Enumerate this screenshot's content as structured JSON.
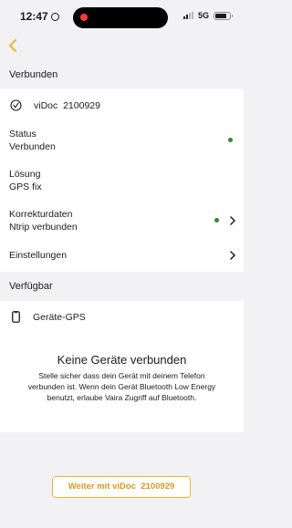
{
  "status_bar": {
    "time": "12:47",
    "network": "5G"
  },
  "sections": {
    "connected": "Verbunden",
    "available": "Verfügbar"
  },
  "device": {
    "name": "viDoc  2100929"
  },
  "rows": {
    "status": {
      "label": "Status",
      "value": "Verbunden"
    },
    "solution": {
      "label": "Lösung",
      "value": "GPS fix"
    },
    "corrections": {
      "label": "Korrekturdaten",
      "value": "Ntrip verbunden"
    },
    "settings": {
      "label": "Einstellungen"
    }
  },
  "available_device": {
    "name": "Geräte-GPS"
  },
  "empty_state": {
    "title": "Keine Geräte verbunden",
    "text": "Stelle sicher dass dein Gerät mit deinem Telefon verbunden ist. Wenn dein Gerät Bluetooth Low Energy benutzt, erlaube Vaira Zugriff auf Bluetooth."
  },
  "continue_button": {
    "label": "Weiter mit viDoc  2100929"
  },
  "colors": {
    "accent": "#f2b233",
    "connected_dot": "#2e8b3e",
    "background": "#f2f2f4"
  },
  "icons": {
    "back": "chevron-left-icon",
    "device": "check-circle-icon",
    "phone": "smartphone-icon",
    "disclosure": "chevron-right-icon"
  }
}
